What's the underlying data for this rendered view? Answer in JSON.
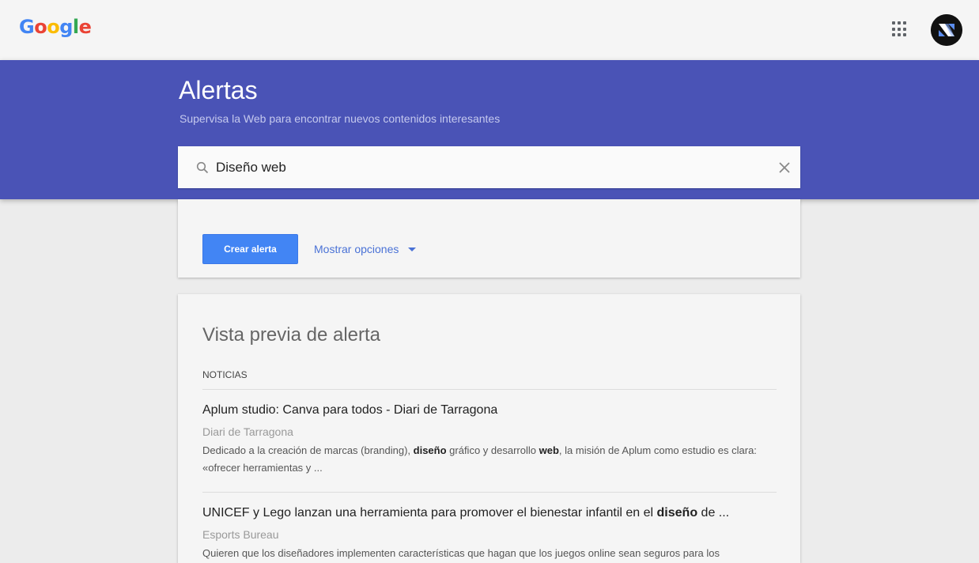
{
  "header": {
    "logo_letters": [
      {
        "ch": "G",
        "color": "#4285f4"
      },
      {
        "ch": "o",
        "color": "#ea4335"
      },
      {
        "ch": "o",
        "color": "#fbbc05"
      },
      {
        "ch": "g",
        "color": "#4285f4"
      },
      {
        "ch": "l",
        "color": "#34a853"
      },
      {
        "ch": "e",
        "color": "#ea4335"
      }
    ],
    "apps_icon": "apps-grid-icon",
    "avatar_icon": "account-avatar"
  },
  "banner": {
    "title": "Alertas",
    "subtitle": "Supervisa la Web para encontrar nuevos contenidos interesantes",
    "color": "#4a53b6"
  },
  "search": {
    "value": "Diseño web",
    "icon": "search-icon",
    "clear_icon": "close-icon"
  },
  "options": {
    "create_label": "Crear alerta",
    "show_options_label": "Mostrar opciones",
    "accent": "#4285f4"
  },
  "preview": {
    "title": "Vista previa de alerta",
    "section": "NOTICIAS",
    "items": [
      {
        "title_parts": [
          {
            "text": "Aplum studio: Canva para todos - Diari de Tarragona",
            "bold": false
          }
        ],
        "source": "Diari de Tarragona",
        "snippet_parts": [
          {
            "text": "Dedicado a la creación de marcas (branding), ",
            "bold": false
          },
          {
            "text": "diseño",
            "bold": true
          },
          {
            "text": " gráfico y desarrollo ",
            "bold": false
          },
          {
            "text": "web",
            "bold": true
          },
          {
            "text": ", la misión de Aplum como estudio es clara: «ofrecer herramientas y ...",
            "bold": false
          }
        ]
      },
      {
        "title_parts": [
          {
            "text": "UNICEF y Lego lanzan una herramienta para promover el bienestar infantil en el ",
            "bold": false
          },
          {
            "text": "diseño",
            "bold": true
          },
          {
            "text": " de ...",
            "bold": false
          }
        ],
        "source": "Esports Bureau",
        "snippet_parts": [
          {
            "text": "Quieren que los diseñadores implementen características que hagan que los juegos online sean seguros para los",
            "bold": false
          }
        ]
      }
    ]
  }
}
